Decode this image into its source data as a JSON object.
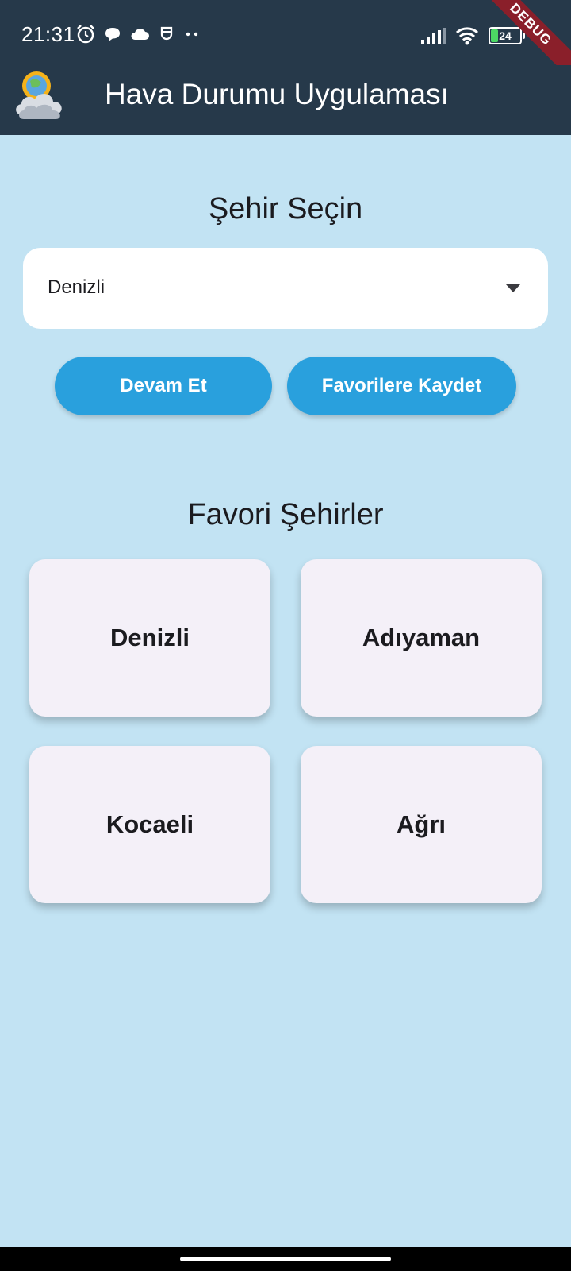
{
  "status_bar": {
    "time": "21:31",
    "battery": "24",
    "left_icons": [
      "alarm-icon",
      "chat-bubble-icon",
      "cloud-icon",
      "notification-icon",
      "more-dots-icon"
    ],
    "right_icons": [
      "signal-icon",
      "wifi-icon",
      "battery-icon"
    ]
  },
  "app_bar": {
    "title": "Hava Durumu Uygulaması",
    "logo_icon": "weather-sun-cloud-icon",
    "background": "#26394a"
  },
  "debug_banner": "DEBUG",
  "city_select": {
    "heading": "Şehir Seçin",
    "selected_value": "Denizli"
  },
  "buttons": {
    "continue": "Devam Et",
    "save_favorite": "Favorilere Kaydet"
  },
  "favorites": {
    "heading": "Favori Şehirler",
    "cities": [
      "Denizli",
      "Adıyaman",
      "Kocaeli",
      "Ağrı"
    ]
  },
  "colors": {
    "background": "#c2e3f3",
    "accent": "#29a0dd",
    "card": "#f4f0f8"
  }
}
